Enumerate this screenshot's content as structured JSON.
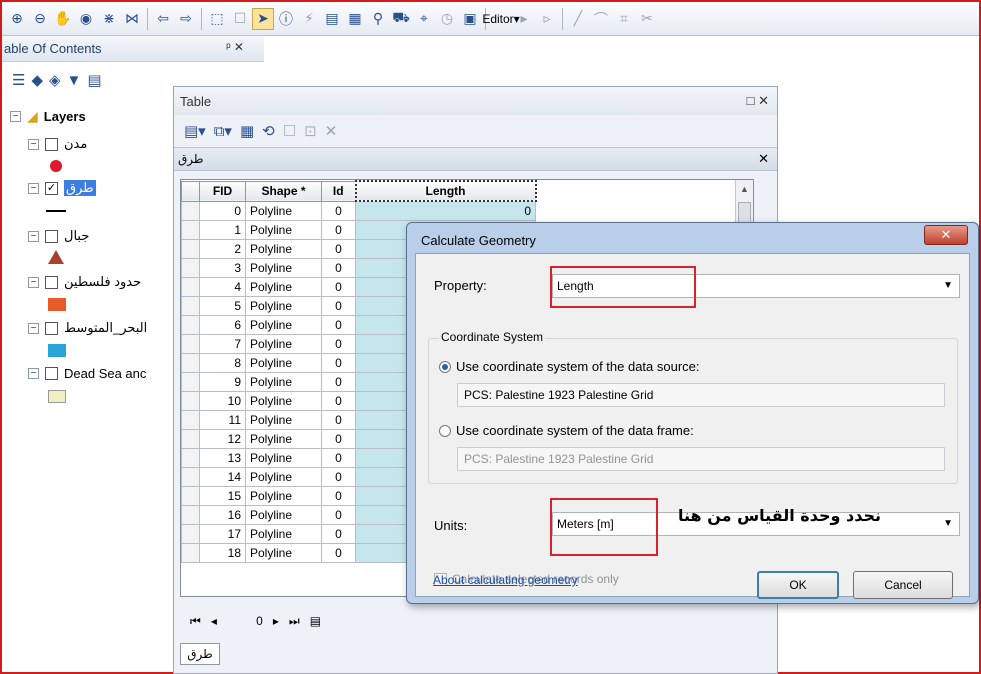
{
  "toolbar": {
    "editor_label": "Editor▾"
  },
  "toc": {
    "title": "able Of Contents",
    "pin_close": "ᵖ ✕",
    "root": "Layers",
    "layers": [
      {
        "label": "مدن",
        "checked": false
      },
      {
        "label": "طرق",
        "checked": true
      },
      {
        "label": "جبال",
        "checked": false
      },
      {
        "label": "حدود فلسطين",
        "checked": false
      },
      {
        "label": "البحر_المتوسط",
        "checked": false
      },
      {
        "label": "Dead Sea anc",
        "checked": false
      }
    ],
    "colors": {
      "point": "#e0182b",
      "mountain": "#a9422c",
      "border": "#e55b2a",
      "sea": "#2aa3d8",
      "deadsea": "#f4efc2"
    }
  },
  "table_window": {
    "title": "Table",
    "controls": "□ ✕",
    "tab_name": "طرق",
    "columns": [
      "FID",
      "Shape *",
      "Id",
      "Length"
    ],
    "rows": [
      [
        "0",
        "Polyline",
        "0",
        "0"
      ],
      [
        "1",
        "Polyline",
        "0",
        ""
      ],
      [
        "2",
        "Polyline",
        "0",
        ""
      ],
      [
        "3",
        "Polyline",
        "0",
        ""
      ],
      [
        "4",
        "Polyline",
        "0",
        ""
      ],
      [
        "5",
        "Polyline",
        "0",
        ""
      ],
      [
        "6",
        "Polyline",
        "0",
        ""
      ],
      [
        "7",
        "Polyline",
        "0",
        ""
      ],
      [
        "8",
        "Polyline",
        "0",
        ""
      ],
      [
        "9",
        "Polyline",
        "0",
        ""
      ],
      [
        "10",
        "Polyline",
        "0",
        ""
      ],
      [
        "11",
        "Polyline",
        "0",
        ""
      ],
      [
        "12",
        "Polyline",
        "0",
        ""
      ],
      [
        "13",
        "Polyline",
        "0",
        ""
      ],
      [
        "14",
        "Polyline",
        "0",
        ""
      ],
      [
        "15",
        "Polyline",
        "0",
        ""
      ],
      [
        "16",
        "Polyline",
        "0",
        ""
      ],
      [
        "17",
        "Polyline",
        "0",
        ""
      ],
      [
        "18",
        "Polyline",
        "0",
        ""
      ]
    ],
    "nav_record": "0",
    "bottom_tab": "طرق"
  },
  "dialog": {
    "title": "Calculate Geometry",
    "close": "✕",
    "property_label": "Property:",
    "property_value": "Length",
    "group_title": "Coordinate System",
    "radio_source": "Use coordinate system of the data source:",
    "source_cs": "PCS: Palestine 1923 Palestine Grid",
    "radio_frame": "Use coordinate system of the data frame:",
    "frame_cs": "PCS: Palestine 1923 Palestine Grid",
    "units_label": "Units:",
    "units_value": "Meters [m]",
    "annotation": "نحدد وحدة القياس من هنا",
    "selected_only": "Calculate selected records only",
    "about_link": "About calculating geometry",
    "ok": "OK",
    "cancel": "Cancel"
  }
}
